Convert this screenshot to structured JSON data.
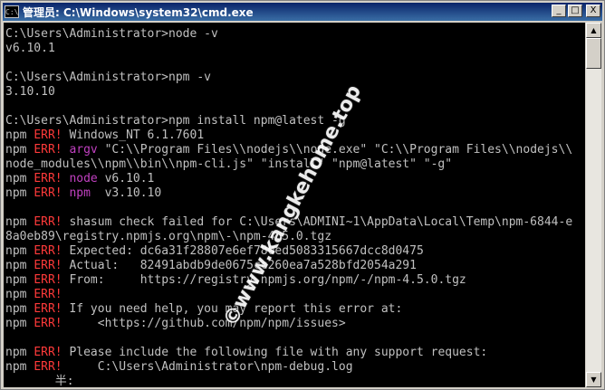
{
  "window": {
    "title": "管理员: C:\\Windows\\system32\\cmd.exe",
    "icon_label": "C:\\",
    "buttons": {
      "minimize": "_",
      "maximize": "□",
      "close": "X"
    }
  },
  "console": {
    "lines": [
      [
        {
          "t": "C:\\Users\\Administrator>node -v",
          "c": "n"
        }
      ],
      [
        {
          "t": "v6.10.1",
          "c": "n"
        }
      ],
      [
        {
          "t": "",
          "c": "n"
        }
      ],
      [
        {
          "t": "C:\\Users\\Administrator>npm -v",
          "c": "n"
        }
      ],
      [
        {
          "t": "3.10.10",
          "c": "n"
        }
      ],
      [
        {
          "t": "",
          "c": "n"
        }
      ],
      [
        {
          "t": "C:\\Users\\Administrator>npm install npm@latest -g",
          "c": "n"
        }
      ],
      [
        {
          "t": "npm ",
          "c": "n"
        },
        {
          "t": "ERR!",
          "c": "e"
        },
        {
          "t": " Windows_NT 6.1.7601",
          "c": "n"
        }
      ],
      [
        {
          "t": "npm ",
          "c": "n"
        },
        {
          "t": "ERR!",
          "c": "e"
        },
        {
          "t": " argv",
          "c": "m"
        },
        {
          "t": " \"C:\\\\Program Files\\\\nodejs\\\\node.exe\" \"C:\\\\Program Files\\\\nodejs\\\\",
          "c": "n"
        }
      ],
      [
        {
          "t": "node_modules\\\\npm\\\\bin\\\\npm-cli.js\" \"install\" \"npm@latest\" \"-g\"",
          "c": "n"
        }
      ],
      [
        {
          "t": "npm ",
          "c": "n"
        },
        {
          "t": "ERR!",
          "c": "e"
        },
        {
          "t": " node",
          "c": "m"
        },
        {
          "t": " v6.10.1",
          "c": "n"
        }
      ],
      [
        {
          "t": "npm ",
          "c": "n"
        },
        {
          "t": "ERR!",
          "c": "e"
        },
        {
          "t": " npm",
          "c": "m"
        },
        {
          "t": "  v3.10.10",
          "c": "n"
        }
      ],
      [
        {
          "t": "",
          "c": "n"
        }
      ],
      [
        {
          "t": "npm ",
          "c": "n"
        },
        {
          "t": "ERR!",
          "c": "e"
        },
        {
          "t": " shasum check failed for C:\\Users\\ADMINI~1\\AppData\\Local\\Temp\\npm-6844-e",
          "c": "n"
        }
      ],
      [
        {
          "t": "8a0eb89\\registry.npmjs.org\\npm\\-\\npm-4.5.0.tgz",
          "c": "n"
        }
      ],
      [
        {
          "t": "npm ",
          "c": "n"
        },
        {
          "t": "ERR!",
          "c": "e"
        },
        {
          "t": " Expected: dc6a31f28807e6ef780ed5083315667dcc8d0475",
          "c": "n"
        }
      ],
      [
        {
          "t": "npm ",
          "c": "n"
        },
        {
          "t": "ERR!",
          "c": "e"
        },
        {
          "t": " Actual:   82491abdb9de0675cc260ea7a528bfd2054a291",
          "c": "n"
        }
      ],
      [
        {
          "t": "npm ",
          "c": "n"
        },
        {
          "t": "ERR!",
          "c": "e"
        },
        {
          "t": " From:     https://registry.npmjs.org/npm/-/npm-4.5.0.tgz",
          "c": "n"
        }
      ],
      [
        {
          "t": "npm ",
          "c": "n"
        },
        {
          "t": "ERR!",
          "c": "e"
        }
      ],
      [
        {
          "t": "npm ",
          "c": "n"
        },
        {
          "t": "ERR!",
          "c": "e"
        },
        {
          "t": " If you need help, you may report this error at:",
          "c": "n"
        }
      ],
      [
        {
          "t": "npm ",
          "c": "n"
        },
        {
          "t": "ERR!",
          "c": "e"
        },
        {
          "t": "     <https://github.com/npm/npm/issues>",
          "c": "n"
        }
      ],
      [
        {
          "t": "",
          "c": "n"
        }
      ],
      [
        {
          "t": "npm ",
          "c": "n"
        },
        {
          "t": "ERR!",
          "c": "e"
        },
        {
          "t": " Please include the following file with any support request:",
          "c": "n"
        }
      ],
      [
        {
          "t": "npm ",
          "c": "n"
        },
        {
          "t": "ERR!",
          "c": "e"
        },
        {
          "t": "     C:\\Users\\Administrator\\npm-debug.log",
          "c": "n"
        }
      ],
      [
        {
          "t": "       半:",
          "c": "n"
        }
      ]
    ]
  },
  "watermark": {
    "text": "©www.kangkehome.top"
  },
  "scrollbar": {
    "up_arrow": "▲",
    "down_arrow": "▼",
    "position": 0
  },
  "colors": {
    "console_bg": "#000000",
    "console_text": "#c0c0c0",
    "error": "#ff3a3a",
    "keyword": "#c040c0",
    "title_bar": "#0a246a"
  }
}
